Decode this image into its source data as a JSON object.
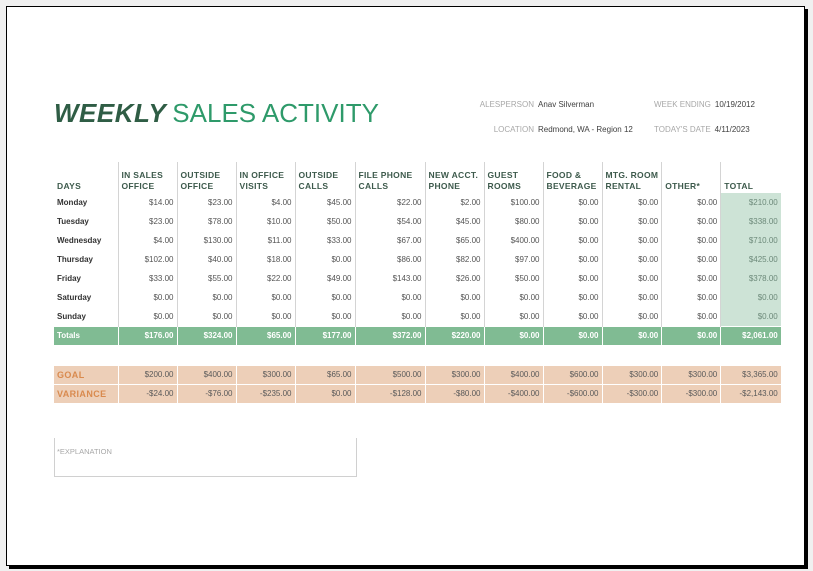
{
  "title": {
    "bold": "WEEKLY",
    "rest": "SALES ACTIVITY"
  },
  "meta": {
    "salesperson_label": "ALESPERSON",
    "salesperson": "Anav Silverman",
    "location_label": "LOCATION",
    "location": "Redmond, WA - Region 12",
    "week_ending_label": "WEEK ENDING",
    "week_ending": "10/19/2012",
    "todays_date_label": "TODAY'S DATE",
    "todays_date": "4/11/2023"
  },
  "columns": [
    [
      "DAYS",
      ""
    ],
    [
      "IN SALES",
      "OFFICE"
    ],
    [
      "OUTSIDE",
      "OFFICE"
    ],
    [
      "IN OFFICE",
      "VISITS"
    ],
    [
      "OUTSIDE",
      "CALLS"
    ],
    [
      "FILE PHONE",
      "CALLS"
    ],
    [
      "NEW ACCT.",
      "PHONE"
    ],
    [
      "GUEST",
      "ROOMS"
    ],
    [
      "FOOD &",
      "BEVERAGE"
    ],
    [
      "MTG. ROOM",
      "RENTAL"
    ],
    [
      "",
      "OTHER*"
    ],
    [
      "",
      "TOTAL"
    ]
  ],
  "rows": [
    {
      "day": "Monday",
      "values": [
        "$14.00",
        "$23.00",
        "$4.00",
        "$45.00",
        "$22.00",
        "$2.00",
        "$100.00",
        "$0.00",
        "$0.00",
        "$0.00",
        "$210.00"
      ]
    },
    {
      "day": "Tuesday",
      "values": [
        "$23.00",
        "$78.00",
        "$10.00",
        "$50.00",
        "$54.00",
        "$45.00",
        "$80.00",
        "$0.00",
        "$0.00",
        "$0.00",
        "$338.00"
      ]
    },
    {
      "day": "Wednesday",
      "values": [
        "$4.00",
        "$130.00",
        "$11.00",
        "$33.00",
        "$67.00",
        "$65.00",
        "$400.00",
        "$0.00",
        "$0.00",
        "$0.00",
        "$710.00"
      ]
    },
    {
      "day": "Thursday",
      "values": [
        "$102.00",
        "$40.00",
        "$18.00",
        "$0.00",
        "$86.00",
        "$82.00",
        "$97.00",
        "$0.00",
        "$0.00",
        "$0.00",
        "$425.00"
      ]
    },
    {
      "day": "Friday",
      "values": [
        "$33.00",
        "$55.00",
        "$22.00",
        "$49.00",
        "$143.00",
        "$26.00",
        "$50.00",
        "$0.00",
        "$0.00",
        "$0.00",
        "$378.00"
      ]
    },
    {
      "day": "Saturday",
      "values": [
        "$0.00",
        "$0.00",
        "$0.00",
        "$0.00",
        "$0.00",
        "$0.00",
        "$0.00",
        "$0.00",
        "$0.00",
        "$0.00",
        "$0.00"
      ]
    },
    {
      "day": "Sunday",
      "values": [
        "$0.00",
        "$0.00",
        "$0.00",
        "$0.00",
        "$0.00",
        "$0.00",
        "$0.00",
        "$0.00",
        "$0.00",
        "$0.00",
        "$0.00"
      ]
    }
  ],
  "totals": {
    "label": "Totals",
    "values": [
      "$176.00",
      "$324.00",
      "$65.00",
      "$177.00",
      "$372.00",
      "$220.00",
      "$0.00",
      "$0.00",
      "$0.00",
      "$0.00",
      "$2,061.00"
    ]
  },
  "goal": {
    "label": "GOAL",
    "values": [
      "$200.00",
      "$400.00",
      "$300.00",
      "$65.00",
      "$500.00",
      "$300.00",
      "$400.00",
      "$600.00",
      "$300.00",
      "$300.00",
      "$3,365.00"
    ]
  },
  "variance": {
    "label": "VARIANCE",
    "values": [
      "-$24.00",
      "-$76.00",
      "-$235.00",
      "$0.00",
      "-$128.00",
      "-$80.00",
      "-$400.00",
      "-$600.00",
      "-$300.00",
      "-$300.00",
      "-$2,143.00"
    ]
  },
  "explanation_label": "*EXPLANATION"
}
